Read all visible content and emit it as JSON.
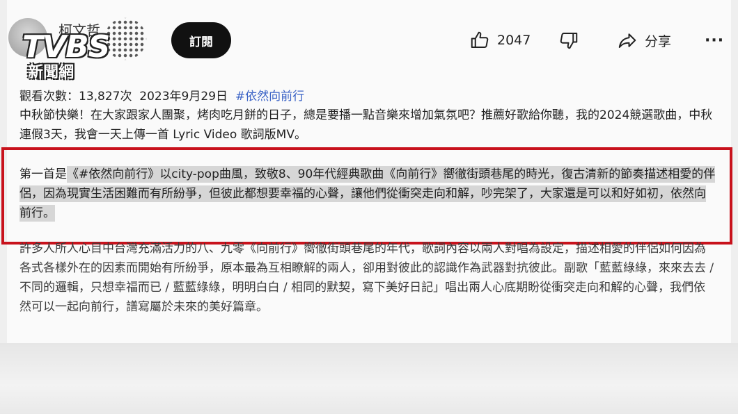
{
  "channel": {
    "name": "柯文哲",
    "subscribe_label": "訂閱"
  },
  "watermark": {
    "logo_text": "TVBS",
    "logo_sub": "新聞網"
  },
  "actions": {
    "like_icon": "thumbs-up-icon",
    "like_count": "2047",
    "dislike_icon": "thumbs-down-icon",
    "share_icon": "share-icon",
    "share_label": "分享",
    "more_label": "···"
  },
  "description": {
    "view_count_label": "觀看次數：13,827次",
    "date": "2023年9月29日",
    "hashtag": "#依然向前行",
    "paragraph_1": "中秋節快樂！在大家跟家人團聚，烤肉吃月餅的日子，總是要播一點音樂來增加氣氛吧？推薦好歌給你聽，我的2024競選歌曲，中秋連假3天，我會一天上傳一首 Lyric Video 歌詞版MV。",
    "paragraph_2_prefix": "第一首是",
    "paragraph_2_highlight": "《#依然向前行》以city-pop曲風，致敬8、90年代經典歌曲《向前行》嚮徹街頭巷尾的時光，復古清新的節奏描述相愛的伴侶，因為現實生活困難而有所紛爭，但彼此都想要幸福的心聲，讓他們從衝突走向和解，吵完架了，大家還是可以和好如初，依然向前行。",
    "paragraph_3": "許多人所人心目中台灣充滿活力的八、九零《向前行》嚮徹街頭巷尾的年代，歌詞內容以兩人對唱為設定，描述相愛的伴侶如何因為各式各樣外在的因素而開始有所紛爭，原本最為互相瞭解的兩人，卻用對彼此的認識作為武器對抗彼此。副歌「藍藍綠綠，來來去去 / 不同的邏輯，只想幸福而已 / 藍藍綠綠，明明白白 / 相同的默契，寫下美好日記」唱出兩人心底期盼從衝突走向和解的心聲，我們依然可以一起向前行，譜寫屬於未來的美好篇章。"
  },
  "colors": {
    "highlight_border": "#c8121c",
    "hashtag": "#3b63c6",
    "subscribe_bg": "#111111"
  }
}
